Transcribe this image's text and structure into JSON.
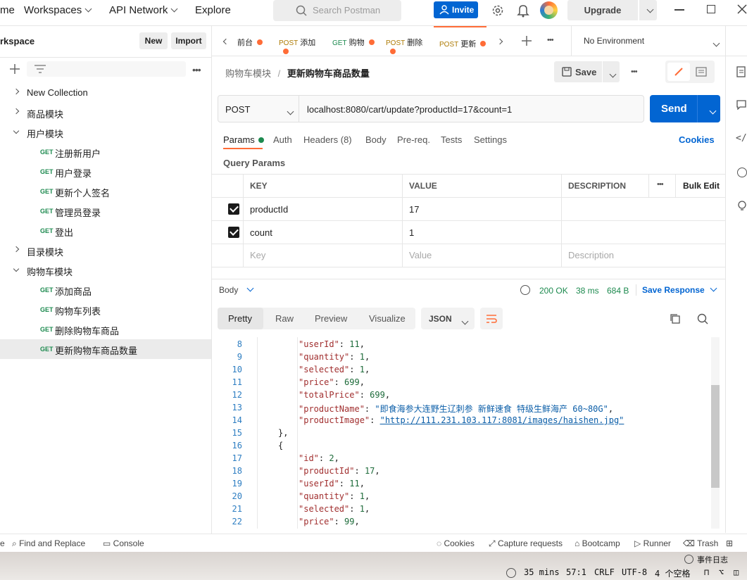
{
  "topbar": {
    "partial_left": "me",
    "workspaces": "Workspaces",
    "api_network": "API Network",
    "explore": "Explore",
    "search_placeholder": "Search Postman",
    "invite": "Invite",
    "upgrade": "Upgrade"
  },
  "sidebar": {
    "title": "rkspace",
    "new_btn": "New",
    "import_btn": "Import",
    "items": [
      {
        "label": "New Collection",
        "level": 0,
        "expanded": false
      },
      {
        "label": "商品模块",
        "level": 0,
        "expanded": false
      },
      {
        "label": "用户模块",
        "level": 0,
        "expanded": true
      },
      {
        "label": "注册新用户",
        "level": 1,
        "method": "GET"
      },
      {
        "label": "用户登录",
        "level": 1,
        "method": "GET"
      },
      {
        "label": "更新个人签名",
        "level": 1,
        "method": "GET"
      },
      {
        "label": "管理员登录",
        "level": 1,
        "method": "GET"
      },
      {
        "label": "登出",
        "level": 1,
        "method": "GET"
      },
      {
        "label": "目录模块",
        "level": 0,
        "expanded": false
      },
      {
        "label": "购物车模块",
        "level": 0,
        "expanded": true
      },
      {
        "label": "添加商品",
        "level": 1,
        "method": "GET"
      },
      {
        "label": "购物车列表",
        "level": 1,
        "method": "GET"
      },
      {
        "label": "删除购物车商品",
        "level": 1,
        "method": "GET"
      },
      {
        "label": "更新购物车商品数量",
        "level": 1,
        "method": "GET",
        "selected": true
      }
    ]
  },
  "tabs": [
    {
      "method": "",
      "label": "前台"
    },
    {
      "method": "POST",
      "label": "添加"
    },
    {
      "method": "GET",
      "label": "购物"
    },
    {
      "method": "POST",
      "label": "删除"
    },
    {
      "method": "POST",
      "label": "更新",
      "active": true
    }
  ],
  "environment": "No Environment",
  "breadcrumb": {
    "parent": "购物车模块",
    "sep": "/",
    "current": "更新购物车商品数量"
  },
  "save": "Save",
  "request": {
    "method": "POST",
    "url": "localhost:8080/cart/update?productId=17&count=1",
    "send": "Send"
  },
  "req_tabs": [
    "Params",
    "Auth",
    "Headers (8)",
    "Body",
    "Pre-req.",
    "Tests",
    "Settings"
  ],
  "cookies": "Cookies",
  "query_params_title": "Query Params",
  "params_table": {
    "headers": [
      "KEY",
      "VALUE",
      "DESCRIPTION"
    ],
    "bulk_edit": "Bulk Edit",
    "rows": [
      {
        "key": "productId",
        "value": "17",
        "checked": true
      },
      {
        "key": "count",
        "value": "1",
        "checked": true
      }
    ],
    "placeholder": {
      "key": "Key",
      "value": "Value",
      "description": "Description"
    }
  },
  "response": {
    "body_label": "Body",
    "status": "200 OK",
    "time": "38 ms",
    "size": "684 B",
    "save_response": "Save Response",
    "view_tabs": [
      "Pretty",
      "Raw",
      "Preview",
      "Visualize"
    ],
    "format": "JSON"
  },
  "code_lines": [
    {
      "n": "8",
      "indent": 12,
      "key": "userId",
      "val": "11",
      "type": "num",
      "comma": true
    },
    {
      "n": "9",
      "indent": 12,
      "key": "quantity",
      "val": "1",
      "type": "num",
      "comma": true
    },
    {
      "n": "10",
      "indent": 12,
      "key": "selected",
      "val": "1",
      "type": "num",
      "comma": true
    },
    {
      "n": "11",
      "indent": 12,
      "key": "price",
      "val": "699",
      "type": "num",
      "comma": true
    },
    {
      "n": "12",
      "indent": 12,
      "key": "totalPrice",
      "val": "699",
      "type": "num",
      "comma": true
    },
    {
      "n": "13",
      "indent": 12,
      "key": "productName",
      "val": "即食海参大连野生辽刺参 新鲜速食 特级生鲜海产 60~80G",
      "type": "str",
      "comma": true
    },
    {
      "n": "14",
      "indent": 12,
      "key": "productImage",
      "val": "http://111.231.103.117:8081/images/haishen.jpg",
      "type": "link",
      "comma": false
    },
    {
      "n": "15",
      "indent": 8,
      "raw": "},"
    },
    {
      "n": "16",
      "indent": 8,
      "raw": "{"
    },
    {
      "n": "17",
      "indent": 12,
      "key": "id",
      "val": "2",
      "type": "num",
      "comma": true
    },
    {
      "n": "18",
      "indent": 12,
      "key": "productId",
      "val": "17",
      "type": "num",
      "comma": true
    },
    {
      "n": "19",
      "indent": 12,
      "key": "userId",
      "val": "11",
      "type": "num",
      "comma": true
    },
    {
      "n": "20",
      "indent": 12,
      "key": "quantity",
      "val": "1",
      "type": "num",
      "comma": true
    },
    {
      "n": "21",
      "indent": 12,
      "key": "selected",
      "val": "1",
      "type": "num",
      "comma": true
    },
    {
      "n": "22",
      "indent": 12,
      "key": "price",
      "val": "99",
      "type": "num",
      "comma": true
    }
  ],
  "statusbar": {
    "partial": "e",
    "find_replace": "Find and Replace",
    "console": "Console",
    "cookies": "Cookies",
    "capture": "Capture requests",
    "bootcamp": "Bootcamp",
    "runner": "Runner",
    "trash": "Trash"
  },
  "ide": {
    "event_log": "事件日志",
    "time": "35 mins",
    "pos": "57:1",
    "eol": "CRLF",
    "enc": "UTF-8",
    "indent": "4 个空格"
  },
  "colors": {
    "accent": "#ff6c37",
    "send_blue": "#0265d2",
    "ok_green": "#1d8a4f"
  }
}
